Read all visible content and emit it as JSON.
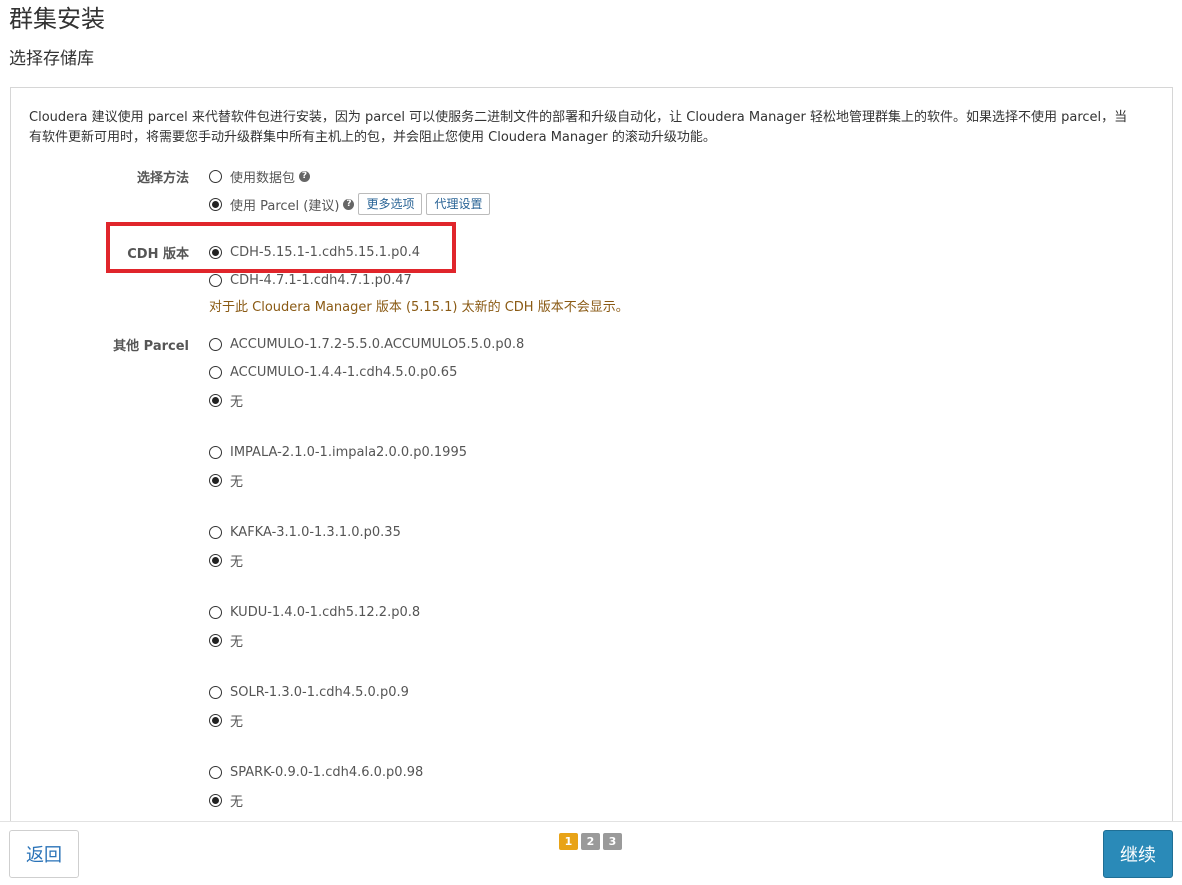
{
  "header": {
    "title": "群集安装",
    "subtitle": "选择存储库"
  },
  "intro_text": "Cloudera 建议使用 parcel 来代替软件包进行安装，因为 parcel 可以使服务二进制文件的部署和升级自动化，让 Cloudera Manager 轻松地管理群集上的软件。如果选择不使用 parcel，当有软件更新可用时，将需要您手动升级群集中所有主机上的包，并会阻止您使用 Cloudera Manager 的滚动升级功能。",
  "method": {
    "label": "选择方法",
    "options": [
      {
        "label": "使用数据包",
        "checked": false
      },
      {
        "label": "使用 Parcel (建议)",
        "checked": true
      }
    ],
    "more_options_label": "更多选项",
    "proxy_settings_label": "代理设置"
  },
  "cdh": {
    "label": "CDH 版本",
    "options": [
      {
        "label": "CDH-5.15.1-1.cdh5.15.1.p0.4",
        "checked": true
      },
      {
        "label": "CDH-4.7.1-1.cdh4.7.1.p0.47",
        "checked": false
      }
    ],
    "notice": "对于此 Cloudera Manager 版本 (5.15.1) 太新的 CDH 版本不会显示。"
  },
  "other_parcels": {
    "label": "其他 Parcel",
    "none_label": "无",
    "groups": [
      {
        "options": [
          "ACCUMULO-1.7.2-5.5.0.ACCUMULO5.5.0.p0.8",
          "ACCUMULO-1.4.4-1.cdh4.5.0.p0.65"
        ]
      },
      {
        "options": [
          "IMPALA-2.1.0-1.impala2.0.0.p0.1995"
        ]
      },
      {
        "options": [
          "KAFKA-3.1.0-1.3.1.0.p0.35"
        ]
      },
      {
        "options": [
          "KUDU-1.4.0-1.cdh5.12.2.p0.8"
        ]
      },
      {
        "options": [
          "SOLR-1.3.0-1.cdh4.5.0.p0.9"
        ]
      },
      {
        "options": [
          "SPARK-0.9.0-1.cdh4.6.0.p0.98"
        ]
      }
    ]
  },
  "footer": {
    "back_label": "返回",
    "continue_label": "继续",
    "steps": [
      "1",
      "2",
      "3"
    ],
    "current_step": 1
  },
  "colors": {
    "highlight": "#e0252b",
    "primary": "#2a8ab8",
    "step_active": "#e8a317",
    "notice": "#8a5a14"
  }
}
